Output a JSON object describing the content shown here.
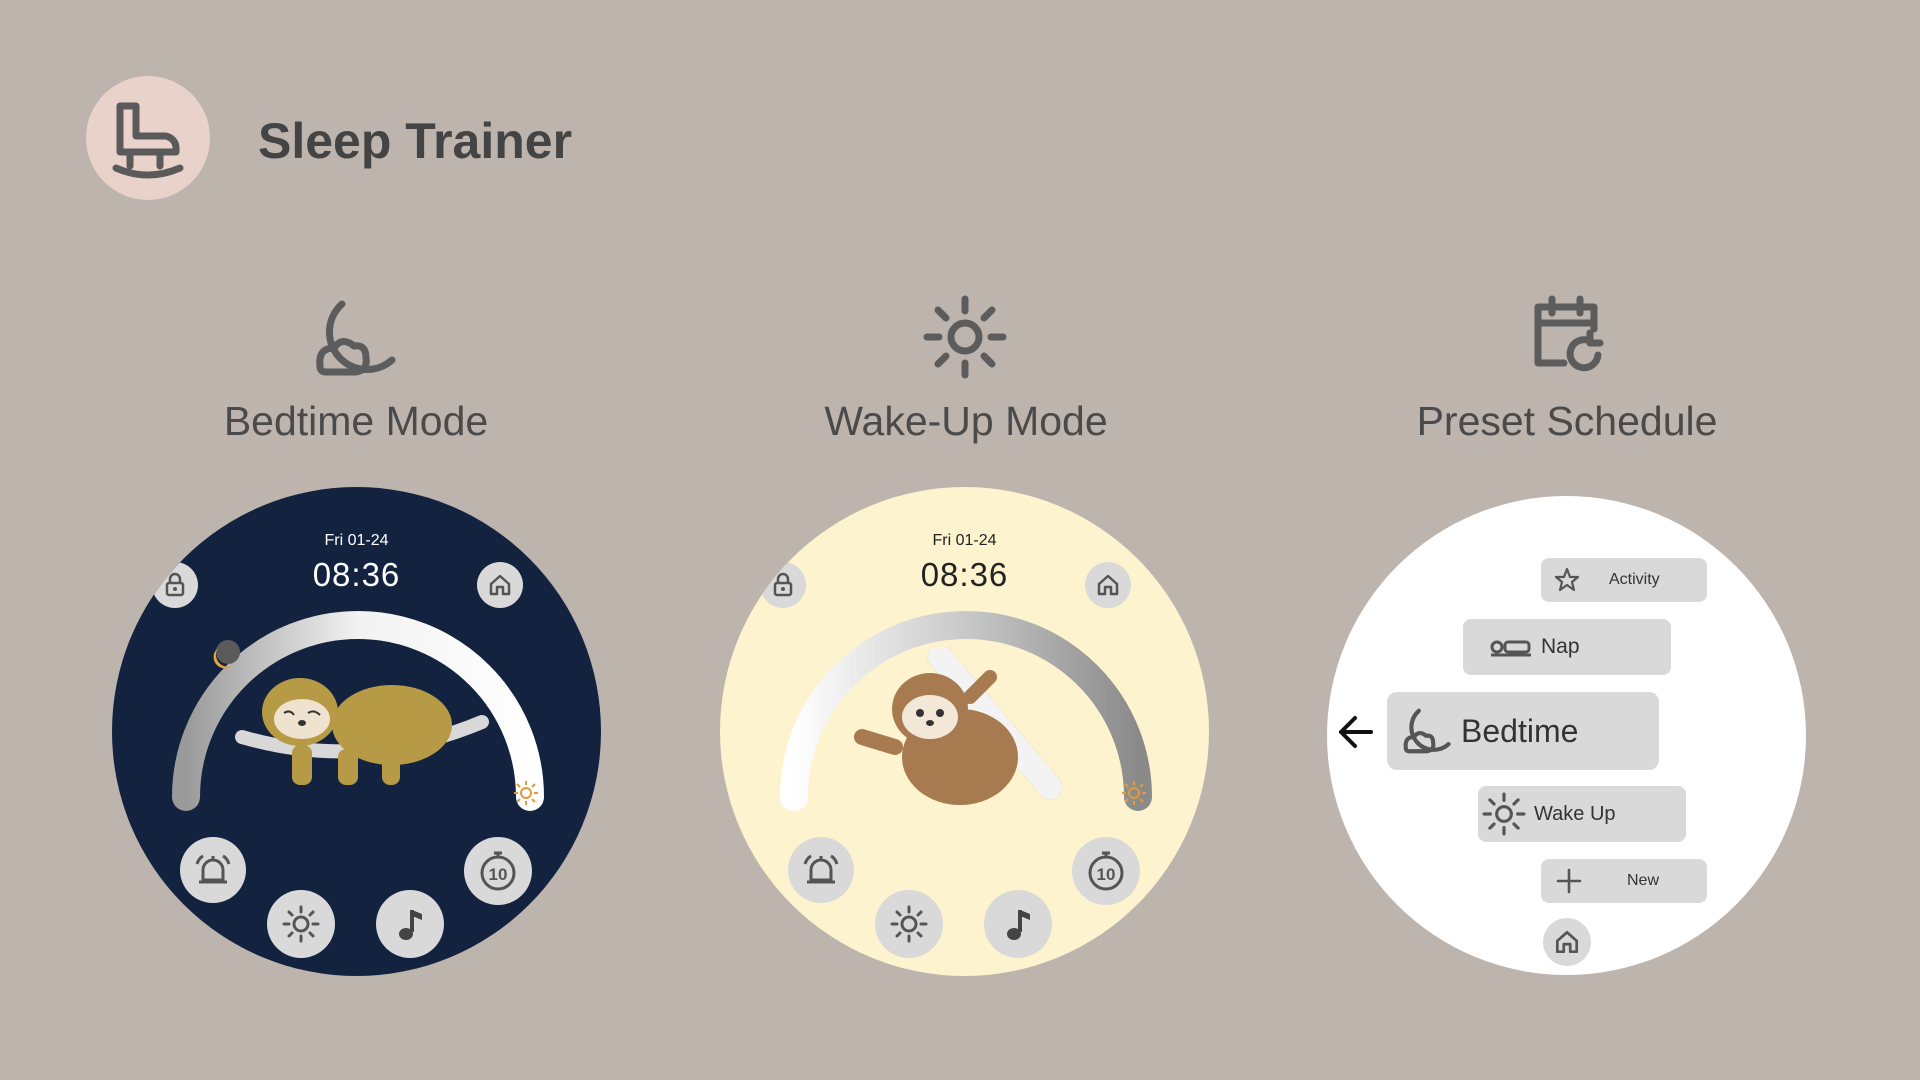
{
  "app": {
    "title": "Sleep Trainer",
    "logo_icon": "rocking-chair-icon"
  },
  "modes": [
    {
      "icon": "moon-icon",
      "label": "Bedtime Mode"
    },
    {
      "icon": "sun-icon",
      "label": "Wake-Up Mode"
    },
    {
      "icon": "calendar-refresh-icon",
      "label": "Preset Schedule"
    }
  ],
  "bedtime_watch": {
    "date": "Fri 01-24",
    "time": "08:36",
    "background": "#13233f",
    "text_color": "#ffffff",
    "buttons": [
      "lock-icon",
      "home-icon",
      "alarm-icon",
      "light-icon",
      "music-icon",
      "timer-10-icon"
    ]
  },
  "wakeup_watch": {
    "date": "Fri 01-24",
    "time": "08:36",
    "background": "#fdf3ce",
    "text_color": "#222222",
    "buttons": [
      "lock-icon",
      "home-icon",
      "alarm-icon",
      "light-icon",
      "music-icon",
      "timer-10-icon"
    ]
  },
  "preset_watch": {
    "items": [
      {
        "label": "Activity",
        "icon": "star-icon"
      },
      {
        "label": "Nap",
        "icon": "bed-icon"
      },
      {
        "label": "Bedtime",
        "icon": "moon-icon"
      },
      {
        "label": "Wake Up",
        "icon": "sun-icon"
      },
      {
        "label": "New",
        "icon": "plus-icon"
      }
    ],
    "back_icon": "arrow-left-icon",
    "home_icon": "home-icon"
  },
  "colors": {
    "accent_orange": "#e59a3a",
    "sloth_olive": "#b69a45",
    "sloth_brown": "#a87a50"
  }
}
